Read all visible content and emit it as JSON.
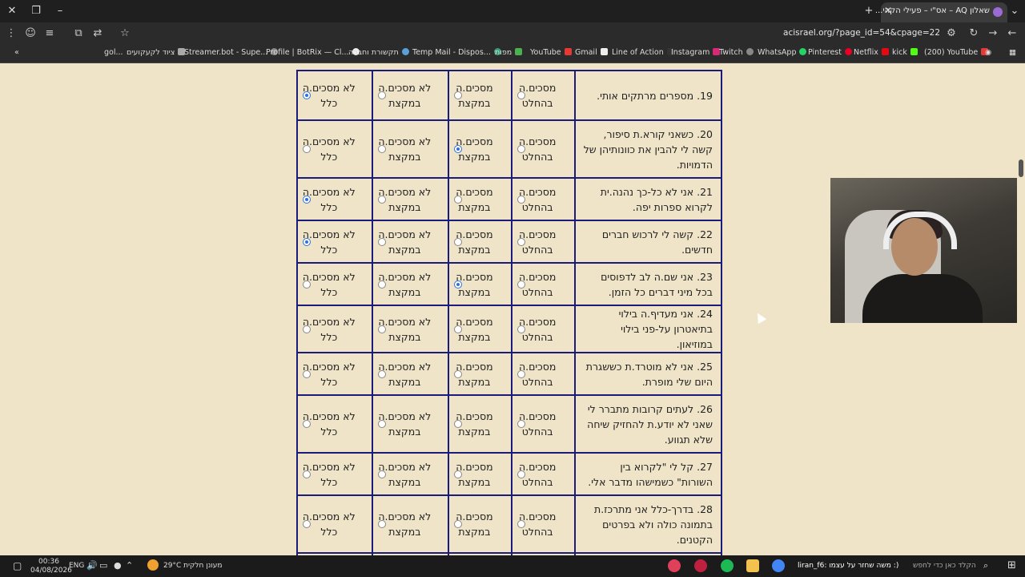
{
  "browser": {
    "tab_title": "שאלון AQ – אס\"י – פעילי הקהי...",
    "url": "acisrael.org/?page_id=54&cpage=22",
    "bookmarks": [
      "gol...",
      "ציוד לקעקועים",
      "Streamer.bot - Supe...",
      "Profile | BotRix — Cl...",
      "תקשורת וחברה",
      "Temp Mail - Dispos...",
      "מפות",
      "YouTube",
      "Gmail",
      "Line of Action",
      "Instagram",
      "Twitch",
      "WhatsApp",
      "Pinterest",
      "Netflix",
      "kick",
      "(200) YouTube"
    ],
    "accent_active_radio": "#2f6fe0",
    "table_border": "#1b1b7a",
    "page_background": "#efe4c8"
  },
  "survey": {
    "options": [
      {
        "label_line1": "מסכים.ה",
        "label_line2": "בהחלט"
      },
      {
        "label_line1": "מסכים.ה",
        "label_line2": "במקצת"
      },
      {
        "label_line1": "לא מסכים.ה",
        "label_line2": "במקצת"
      },
      {
        "label_line1": "לא מסכים.ה",
        "label_line2": "כלל"
      }
    ],
    "questions": [
      {
        "text": "19. מספרים מרתקים אותי.",
        "selected": 3
      },
      {
        "text": "20. כשאני קורא.ת סיפור, קשה לי להבין את כוונותיהן של הדמויות.",
        "selected": 1
      },
      {
        "text": "21. אני לא כל-כך נהנה.ית לקרוא ספרות יפה.",
        "selected": 3
      },
      {
        "text": "22. קשה לי לרכוש חברים חדשים.",
        "selected": 3
      },
      {
        "text": "23. אני שם.ה לב לדפוסים בכל מיני דברים כל הזמן.",
        "selected": 1
      },
      {
        "text": "24. אני מעדיף.ה בילוי בתיאטרון על-פני בילוי במוזיאון.",
        "selected": -1
      },
      {
        "text": "25. אני לא מוטרד.ת כששגרת היום שלי מופרת.",
        "selected": -1
      },
      {
        "text": "26. לעתים קרובות מתברר לי שאני לא יודע.ת להחזיק שיחה שלא תגווע.",
        "selected": -1
      },
      {
        "text": "27. קל לי \"לקרוא בין השורות\" כשמישהו מדבר אלי.",
        "selected": -1
      },
      {
        "text": "28. בדרך-כלל אני מתרכז.ת בתמונה כולה ולא בפרטים הקטנים.",
        "selected": -1
      }
    ]
  },
  "taskbar": {
    "time": "00:36",
    "date": "04/08/2026",
    "lang": "ENG",
    "weather": "29°C  מעונן חלקית",
    "search_placeholder": "הקלד כאן כדי לחפש",
    "stream_label": "liran_f6: משה שחזר על עצמו :)"
  }
}
